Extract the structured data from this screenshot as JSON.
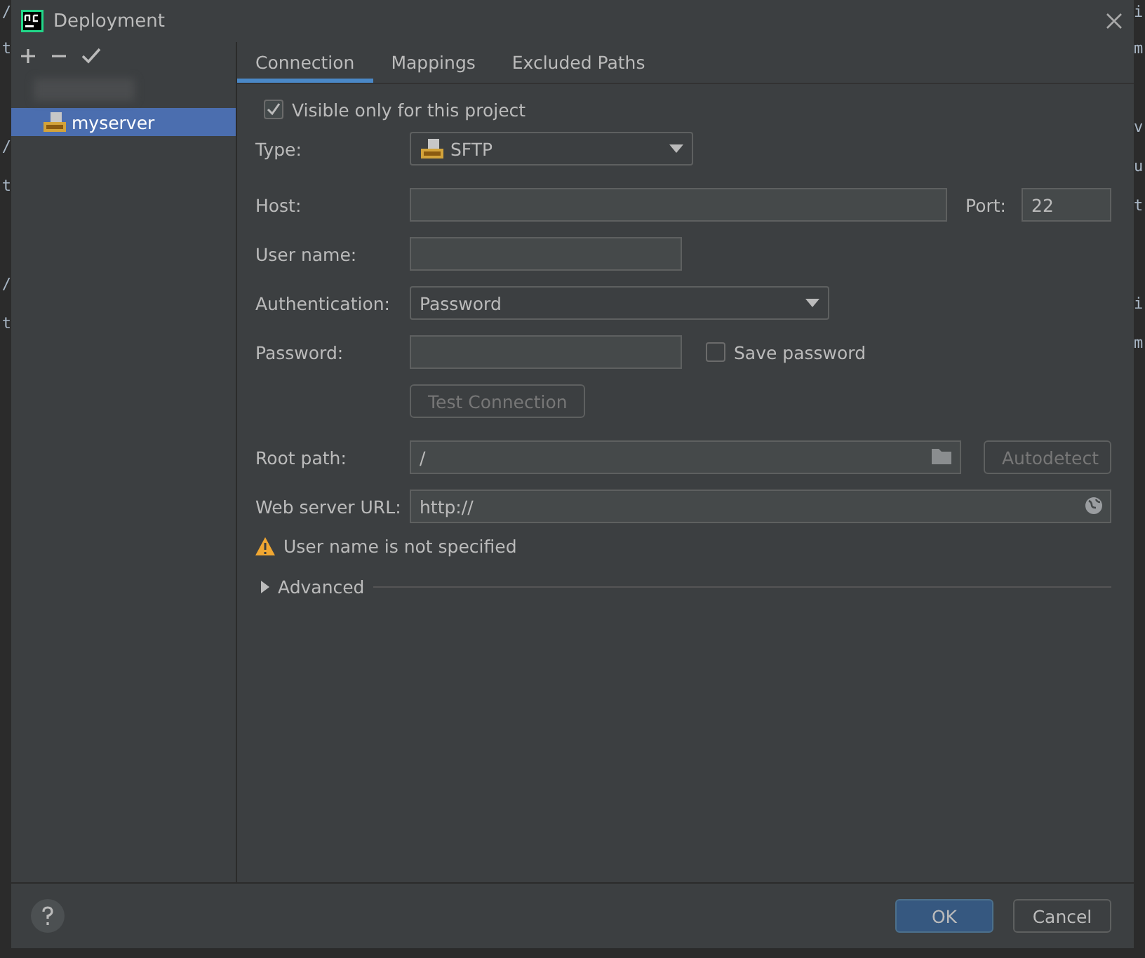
{
  "editor_left": [
    {
      "text": "/"
    },
    {
      "text": "t"
    },
    {
      "text": "/"
    },
    {
      "text": "t"
    },
    {
      "text": "/"
    },
    {
      "text": "t"
    }
  ],
  "editor_right": [
    {
      "text": "i"
    },
    {
      "text": "m"
    },
    {
      "text": "v"
    },
    {
      "text": "u"
    },
    {
      "text": "t"
    },
    {
      "text": "i"
    },
    {
      "text": "m"
    }
  ],
  "window": {
    "title": "Deployment"
  },
  "toolbar": [
    {
      "kind": "add"
    },
    {
      "kind": "remove"
    },
    {
      "kind": "default"
    }
  ],
  "servers": [
    {
      "name": "myserver",
      "selected": true
    }
  ],
  "tabs": [
    {
      "label": "Connection",
      "selected": true
    },
    {
      "label": "Mappings",
      "selected": false
    },
    {
      "label": "Excluded Paths",
      "selected": false
    }
  ],
  "visible_only": {
    "label": "Visible only for this project",
    "checked": true
  },
  "type": {
    "label": "Type:",
    "value": "SFTP"
  },
  "host": {
    "label": "Host:"
  },
  "port": {
    "label": "Port:",
    "value": "22"
  },
  "user_name": {
    "label": "User name:"
  },
  "authentication": {
    "label": "Authentication:",
    "value": "Password"
  },
  "password": {
    "label": "Password:"
  },
  "save_password": {
    "label": "Save password",
    "checked": false
  },
  "test_connection": {
    "label": "Test Connection",
    "disabled": true
  },
  "root_path": {
    "label": "Root path:",
    "value": "/"
  },
  "autodetect": {
    "label": "Autodetect",
    "disabled": true
  },
  "web_server_url": {
    "label": "Web server URL:",
    "value": "http://"
  },
  "warning": "User name is not specified",
  "advanced": {
    "label": "Advanced",
    "expanded": false
  },
  "buttons": [
    {
      "label": "OK",
      "default": true
    },
    {
      "label": "Cancel",
      "default": false
    }
  ]
}
